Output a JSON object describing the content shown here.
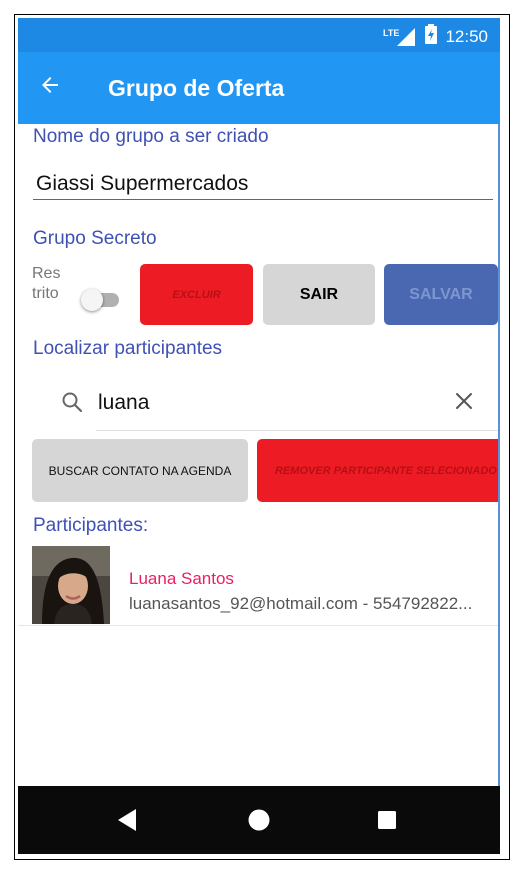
{
  "status_bar": {
    "network": "LTE",
    "time": "12:50"
  },
  "app_bar": {
    "title": "Grupo de Oferta"
  },
  "form": {
    "name_label": "Nome do grupo a ser criado",
    "name_value": "Giassi Supermercados",
    "secret_label": "Grupo Secreto",
    "restrito_label": "Res trito",
    "restrito_on": false
  },
  "buttons": {
    "excluir": "EXCLUIR",
    "sair": "SAIR",
    "salvar": "SALVAR"
  },
  "search": {
    "label": "Localizar participantes",
    "value": "luana"
  },
  "actions": {
    "buscar": "BUSCAR CONTATO NA AGENDA",
    "remover": "REMOVER PARTICIPANTE SELECIONADO"
  },
  "participants": {
    "label": "Participantes:",
    "items": [
      {
        "name": "Luana Santos",
        "detail": "luanasantos_92@hotmail.com - 554792822..."
      }
    ]
  },
  "colors": {
    "status_bar": "#1e88e5",
    "app_bar": "#2196f3",
    "label_blue": "#3f51b5",
    "danger": "#ed1c24",
    "neutral": "#d6d6d6",
    "primary": "#4a67b2",
    "participant_name": "#e91e63"
  },
  "icons": {
    "back": "arrow-left-icon",
    "search": "search-icon",
    "clear": "close-icon",
    "nav_back": "triangle-back-icon",
    "nav_home": "circle-home-icon",
    "nav_recents": "square-recents-icon"
  }
}
